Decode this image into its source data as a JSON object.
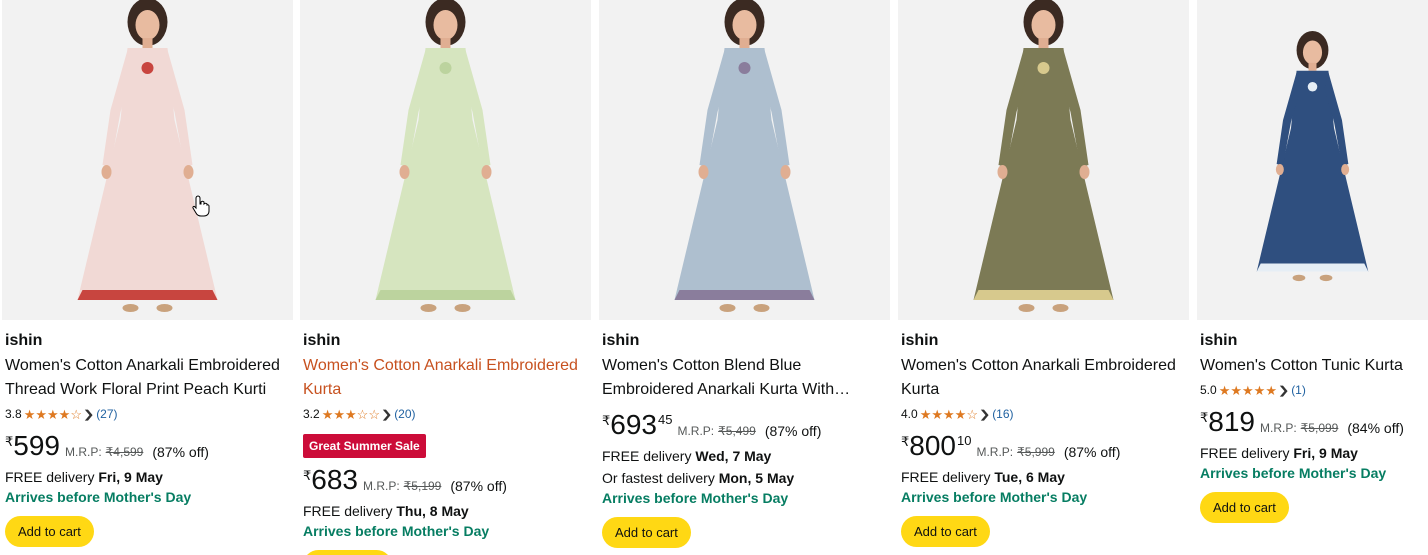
{
  "products": [
    {
      "brand": "ishin",
      "title": "Women's Cotton Anarkali Embroidered Thread Work Floral Print Peach Kurti",
      "title_hover": false,
      "rating": "3.8",
      "stars_filled": 3.8,
      "review_count": "(27)",
      "badge": "",
      "currency": "₹",
      "price_whole": "599",
      "price_fraction": "",
      "mrp_label": "M.R.P:",
      "mrp": "₹4,599",
      "discount": "(87% off)",
      "delivery_prefix": "FREE delivery",
      "delivery_date": "Fri, 9 May",
      "fastest_prefix": "",
      "fastest_date": "",
      "promo": "Arrives before Mother's Day",
      "cart_label": "Add to cart",
      "dress_color": "#f1d9d5",
      "accent_color": "#c8453f"
    },
    {
      "brand": "ishin",
      "title": "Women's Cotton Anarkali Embroidered Kurta",
      "title_hover": true,
      "rating": "3.2",
      "stars_filled": 3.2,
      "review_count": "(20)",
      "badge": "Great Summer Sale",
      "currency": "₹",
      "price_whole": "683",
      "price_fraction": "",
      "mrp_label": "M.R.P:",
      "mrp": "₹5,199",
      "discount": "(87% off)",
      "delivery_prefix": "FREE delivery",
      "delivery_date": "Thu, 8 May",
      "fastest_prefix": "",
      "fastest_date": "",
      "promo": "Arrives before Mother's Day",
      "cart_label": "Add to cart",
      "dress_color": "#d6e5bf",
      "accent_color": "#bcd39e"
    },
    {
      "brand": "ishin",
      "title": "Women's Cotton Blend Blue Embroidered Anarkali Kurta With Dupatta",
      "title_hover": false,
      "rating": "",
      "stars_filled": 0,
      "review_count": "",
      "badge": "",
      "currency": "₹",
      "price_whole": "693",
      "price_fraction": "45",
      "mrp_label": "M.R.P:",
      "mrp": "₹5,499",
      "discount": "(87% off)",
      "delivery_prefix": "FREE delivery",
      "delivery_date": "Wed, 7 May",
      "fastest_prefix": "Or fastest delivery",
      "fastest_date": "Mon, 5 May",
      "promo": "Arrives before Mother's Day",
      "cart_label": "Add to cart",
      "dress_color": "#aebfcf",
      "accent_color": "#8a7d9c"
    },
    {
      "brand": "ishin",
      "title": "Women's Cotton Anarkali Embroidered Kurta",
      "title_hover": false,
      "rating": "4.0",
      "stars_filled": 4.0,
      "review_count": "(16)",
      "badge": "",
      "currency": "₹",
      "price_whole": "800",
      "price_fraction": "10",
      "mrp_label": "M.R.P:",
      "mrp": "₹5,999",
      "discount": "(87% off)",
      "delivery_prefix": "FREE delivery",
      "delivery_date": "Tue, 6 May",
      "fastest_prefix": "",
      "fastest_date": "",
      "promo": "Arrives before Mother's Day",
      "cart_label": "Add to cart",
      "dress_color": "#7c7a55",
      "accent_color": "#d7c98d"
    },
    {
      "brand": "ishin",
      "title": "Women's Cotton Tunic Kurta",
      "title_hover": false,
      "rating": "5.0",
      "stars_filled": 5.0,
      "review_count": "(1)",
      "badge": "",
      "currency": "₹",
      "price_whole": "819",
      "price_fraction": "",
      "mrp_label": "M.R.P:",
      "mrp": "₹5,099",
      "discount": "(84% off)",
      "delivery_prefix": "FREE delivery",
      "delivery_date": "Fri, 9 May",
      "fastest_prefix": "",
      "fastest_date": "",
      "promo": "Arrives before Mother's Day",
      "cart_label": "Add to cart",
      "dress_color": "#2f4f7f",
      "accent_color": "#e6eef5"
    }
  ],
  "colors": {
    "cart_button": "#ffd814",
    "promo_green": "#067d62",
    "star_orange": "#de7921",
    "link_blue": "#2162a1",
    "badge_red": "#cc0c39",
    "hover_title": "#c7511f"
  },
  "icons": {
    "star": "star-icon",
    "chevron": "chevron-down-icon",
    "cursor": "hand-pointer-icon"
  }
}
